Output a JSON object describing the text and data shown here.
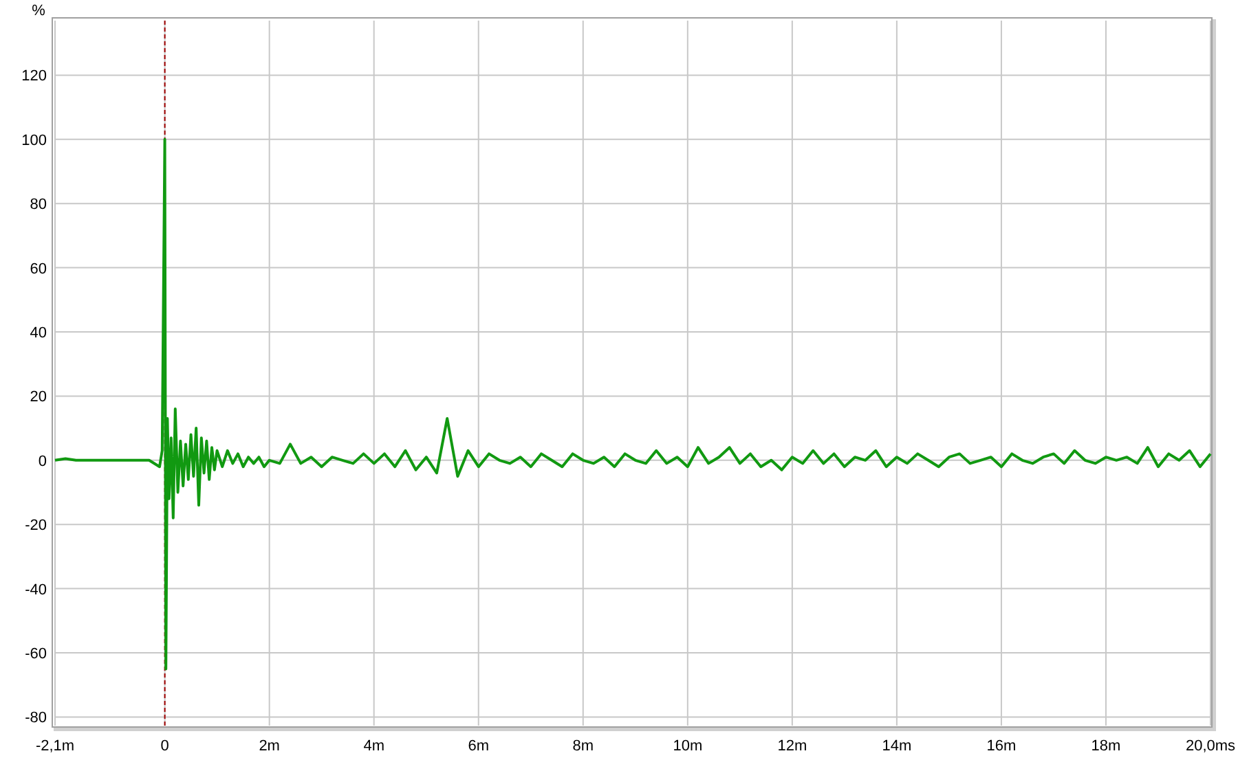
{
  "chart_data": {
    "type": "line",
    "ylabel": "%",
    "xlim": [
      -2.1,
      20.0
    ],
    "ylim": [
      -82.7,
      137
    ],
    "xticks": [
      {
        "value": -2.1,
        "label": "-2,1m"
      },
      {
        "value": 0,
        "label": "0"
      },
      {
        "value": 2,
        "label": "2m"
      },
      {
        "value": 4,
        "label": "4m"
      },
      {
        "value": 6,
        "label": "6m"
      },
      {
        "value": 8,
        "label": "8m"
      },
      {
        "value": 10,
        "label": "10m"
      },
      {
        "value": 12,
        "label": "12m"
      },
      {
        "value": 14,
        "label": "14m"
      },
      {
        "value": 16,
        "label": "16m"
      },
      {
        "value": 18,
        "label": "18m"
      },
      {
        "value": 20,
        "label": "20,0ms"
      }
    ],
    "yticks": [
      -80,
      -60,
      -40,
      -20,
      0,
      20,
      40,
      60,
      80,
      100,
      120
    ],
    "x": [
      -2.1,
      -1.9,
      -1.7,
      -1.5,
      -1.3,
      -1.1,
      -0.9,
      -0.7,
      -0.5,
      -0.3,
      -0.1,
      -0.05,
      0,
      0.02,
      0.05,
      0.08,
      0.12,
      0.16,
      0.2,
      0.25,
      0.3,
      0.35,
      0.4,
      0.45,
      0.5,
      0.55,
      0.6,
      0.65,
      0.7,
      0.75,
      0.8,
      0.85,
      0.9,
      0.95,
      1.0,
      1.1,
      1.2,
      1.3,
      1.4,
      1.5,
      1.6,
      1.7,
      1.8,
      1.9,
      2.0,
      2.2,
      2.4,
      2.6,
      2.8,
      3.0,
      3.2,
      3.4,
      3.6,
      3.8,
      4.0,
      4.2,
      4.4,
      4.6,
      4.8,
      5.0,
      5.2,
      5.4,
      5.6,
      5.8,
      6.0,
      6.2,
      6.4,
      6.6,
      6.8,
      7.0,
      7.2,
      7.4,
      7.6,
      7.8,
      8.0,
      8.2,
      8.4,
      8.6,
      8.8,
      9.0,
      9.2,
      9.4,
      9.6,
      9.8,
      10.0,
      10.2,
      10.4,
      10.6,
      10.8,
      11.0,
      11.2,
      11.4,
      11.6,
      11.8,
      12.0,
      12.2,
      12.4,
      12.6,
      12.8,
      13.0,
      13.2,
      13.4,
      13.6,
      13.8,
      14.0,
      14.2,
      14.4,
      14.6,
      14.8,
      15.0,
      15.2,
      15.4,
      15.6,
      15.8,
      16.0,
      16.2,
      16.4,
      16.6,
      16.8,
      17.0,
      17.2,
      17.4,
      17.6,
      17.8,
      18.0,
      18.2,
      18.4,
      18.6,
      18.8,
      19.0,
      19.2,
      19.4,
      19.6,
      19.8,
      20.0
    ],
    "series": [
      {
        "color": "#119911",
        "values": [
          0,
          0.5,
          0,
          0,
          0,
          0,
          0,
          0,
          0,
          0,
          -2,
          3,
          100,
          -65,
          13,
          -12,
          7,
          -18,
          16,
          -10,
          6,
          -8,
          5,
          -6,
          8,
          -5,
          10,
          -14,
          7,
          -4,
          6,
          -6,
          4,
          -3,
          3,
          -2,
          3,
          -1,
          2,
          -2,
          1,
          -1,
          1,
          -2,
          0,
          -1,
          5,
          -1,
          1,
          -2,
          1,
          0,
          -1,
          2,
          -1,
          2,
          -2,
          3,
          -3,
          1,
          -4,
          13,
          -5,
          3,
          -2,
          2,
          0,
          -1,
          1,
          -2,
          2,
          0,
          -2,
          2,
          0,
          -1,
          1,
          -2,
          2,
          0,
          -1,
          3,
          -1,
          1,
          -2,
          4,
          -1,
          1,
          4,
          -1,
          2,
          -2,
          0,
          -3,
          1,
          -1,
          3,
          -1,
          2,
          -2,
          1,
          0,
          3,
          -2,
          1,
          -1,
          2,
          0,
          -2,
          1,
          2,
          -1,
          0,
          1,
          -2,
          2,
          0,
          -1,
          1,
          2,
          -1,
          3,
          0,
          -1,
          1,
          0,
          1,
          -1,
          4,
          -2,
          2,
          0,
          3,
          -2,
          2
        ]
      }
    ],
    "grid": true,
    "ref_lines": [
      {
        "axis": "x",
        "value": 0,
        "color": "#a00000"
      }
    ]
  }
}
